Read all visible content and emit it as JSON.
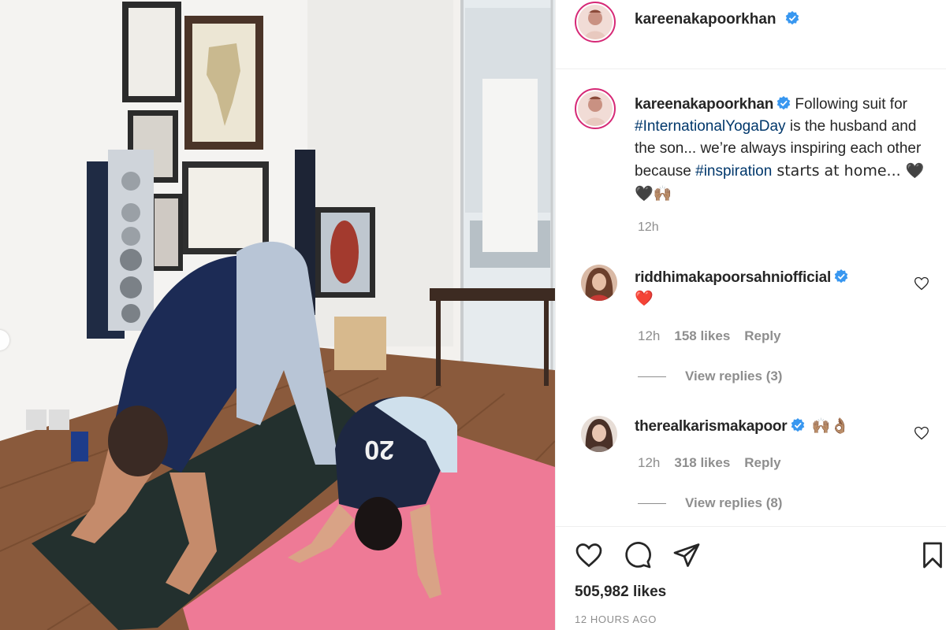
{
  "post": {
    "author": "kareenakapoorkhan",
    "caption_prefix": "Following suit for ",
    "hashtag_1": "#InternationalYogaDay",
    "caption_mid": " is the husband and the son... we’re always inspiring each other because ",
    "hashtag_2": "#inspiration",
    "caption_suffix": " starts at home... 🖤🖤🙌🏽",
    "caption_time": "12h",
    "likes": "505,982 likes",
    "posted_ago": "12 HOURS AGO",
    "shirt_text": "20"
  },
  "comments": [
    {
      "username": "riddhimakapoorsahniofficial",
      "text": "❤️",
      "time": "12h",
      "likes": "158 likes",
      "reply": "Reply",
      "view_replies": "View replies (3)"
    },
    {
      "username": "therealkarismakapoor",
      "text": "🙌🏽👌🏽",
      "time": "12h",
      "likes": "318 likes",
      "reply": "Reply",
      "view_replies": "View replies (8)"
    }
  ],
  "icons": {
    "verified": "verified-badge-icon",
    "like": "heart-outline-icon",
    "comment": "speech-bubble-icon",
    "share": "paper-plane-icon",
    "save": "bookmark-icon"
  },
  "colors": {
    "verified_blue": "#3897f0",
    "hashtag": "#00376b",
    "muted": "#8e8e8e",
    "text": "#262626"
  }
}
